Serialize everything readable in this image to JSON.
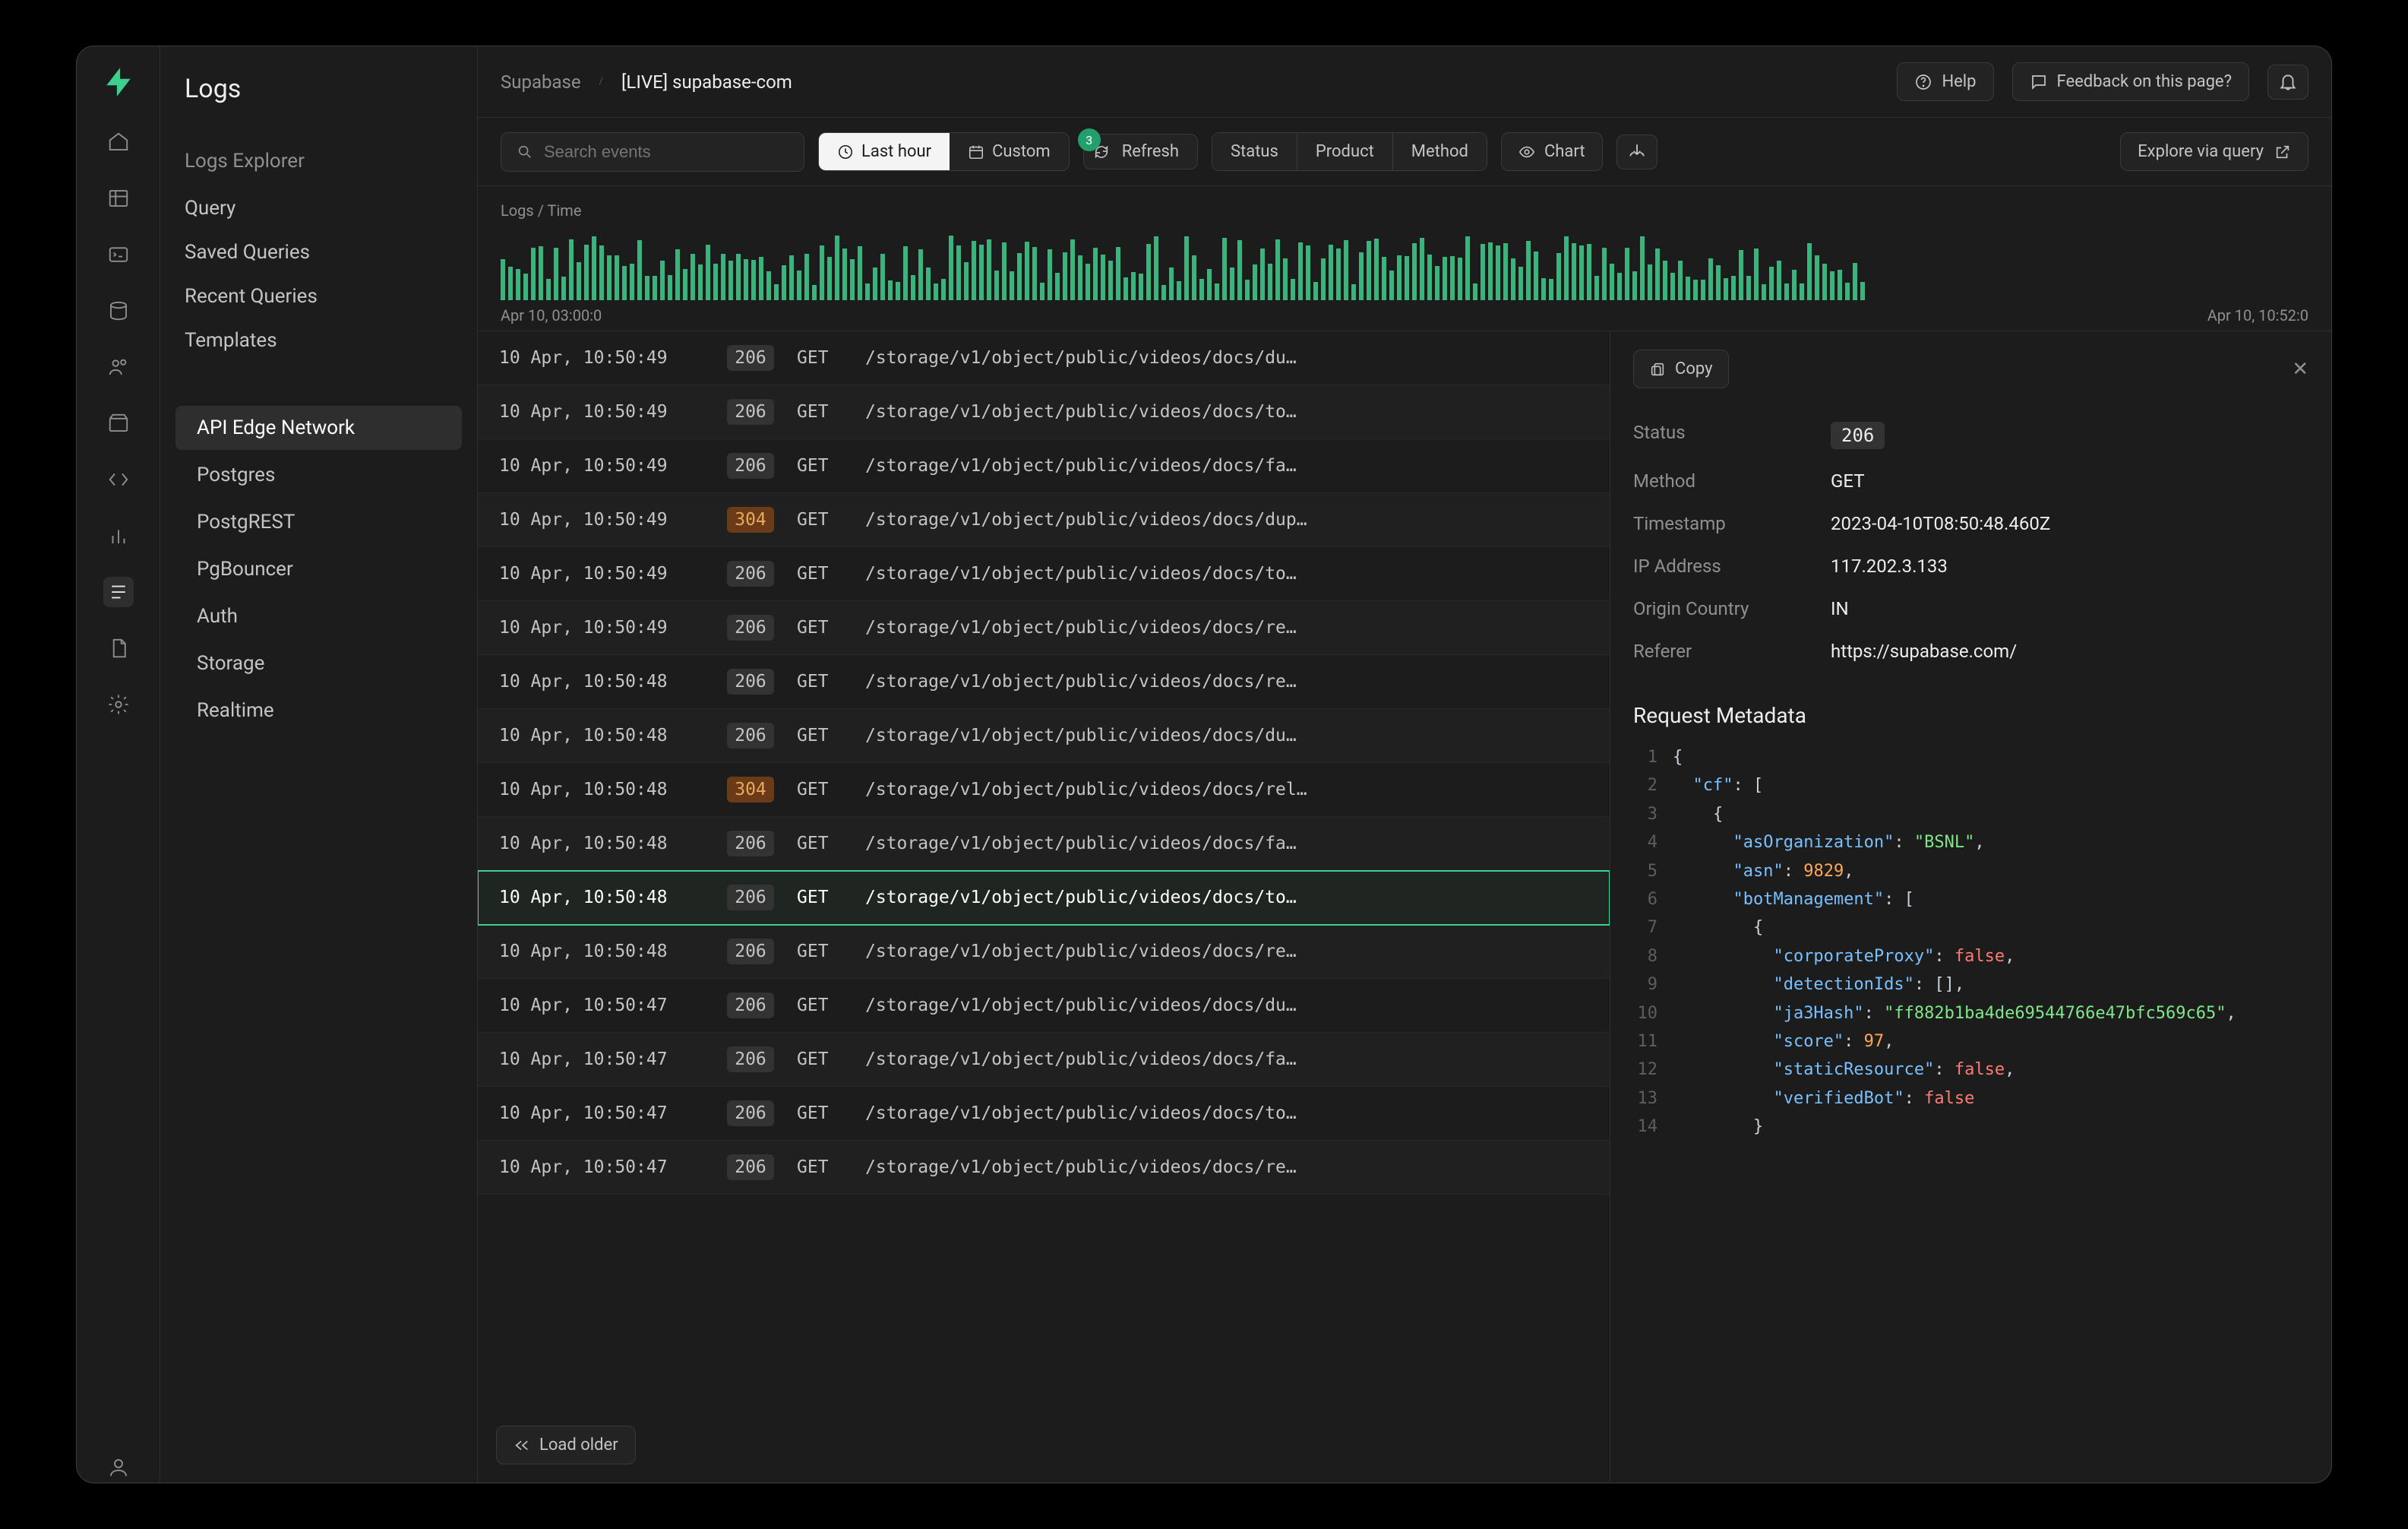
{
  "sidebar": {
    "title": "Logs",
    "explorer_title": "Logs Explorer",
    "explorer_links": [
      "Query",
      "Saved Queries",
      "Recent Queries",
      "Templates"
    ],
    "categories": [
      "API Edge Network",
      "Postgres",
      "PostgREST",
      "PgBouncer",
      "Auth",
      "Storage",
      "Realtime"
    ],
    "active": "API Edge Network"
  },
  "breadcrumb": {
    "org": "Supabase",
    "project": "[LIVE] supabase-com"
  },
  "topbar": {
    "help": "Help",
    "feedback": "Feedback on this page?"
  },
  "toolbar": {
    "search_placeholder": "Search events",
    "last_hour": "Last hour",
    "custom": "Custom",
    "refresh": "Refresh",
    "refresh_badge": "3",
    "filters": [
      "Status",
      "Product",
      "Method"
    ],
    "chart": "Chart",
    "explore": "Explore via query"
  },
  "chart": {
    "title": "Logs / Time",
    "x_start": "Apr 10, 03:00:0",
    "x_end": "Apr 10, 10:52:0"
  },
  "load_older": "Load older",
  "logs": [
    {
      "ts": "10 Apr, 10:50:49",
      "status": 206,
      "method": "GET",
      "path": "/storage/v1/object/public/videos/docs/du…"
    },
    {
      "ts": "10 Apr, 10:50:49",
      "status": 206,
      "method": "GET",
      "path": "/storage/v1/object/public/videos/docs/to…"
    },
    {
      "ts": "10 Apr, 10:50:49",
      "status": 206,
      "method": "GET",
      "path": "/storage/v1/object/public/videos/docs/fa…"
    },
    {
      "ts": "10 Apr, 10:50:49",
      "status": 304,
      "method": "GET",
      "path": "/storage/v1/object/public/videos/docs/dup…"
    },
    {
      "ts": "10 Apr, 10:50:49",
      "status": 206,
      "method": "GET",
      "path": "/storage/v1/object/public/videos/docs/to…"
    },
    {
      "ts": "10 Apr, 10:50:49",
      "status": 206,
      "method": "GET",
      "path": "/storage/v1/object/public/videos/docs/re…"
    },
    {
      "ts": "10 Apr, 10:50:48",
      "status": 206,
      "method": "GET",
      "path": "/storage/v1/object/public/videos/docs/re…"
    },
    {
      "ts": "10 Apr, 10:50:48",
      "status": 206,
      "method": "GET",
      "path": "/storage/v1/object/public/videos/docs/du…"
    },
    {
      "ts": "10 Apr, 10:50:48",
      "status": 304,
      "method": "GET",
      "path": "/storage/v1/object/public/videos/docs/rel…"
    },
    {
      "ts": "10 Apr, 10:50:48",
      "status": 206,
      "method": "GET",
      "path": "/storage/v1/object/public/videos/docs/fa…"
    },
    {
      "ts": "10 Apr, 10:50:48",
      "status": 206,
      "method": "GET",
      "path": "/storage/v1/object/public/videos/docs/to…",
      "selected": true
    },
    {
      "ts": "10 Apr, 10:50:48",
      "status": 206,
      "method": "GET",
      "path": "/storage/v1/object/public/videos/docs/re…"
    },
    {
      "ts": "10 Apr, 10:50:47",
      "status": 206,
      "method": "GET",
      "path": "/storage/v1/object/public/videos/docs/du…"
    },
    {
      "ts": "10 Apr, 10:50:47",
      "status": 206,
      "method": "GET",
      "path": "/storage/v1/object/public/videos/docs/fa…"
    },
    {
      "ts": "10 Apr, 10:50:47",
      "status": 206,
      "method": "GET",
      "path": "/storage/v1/object/public/videos/docs/to…"
    },
    {
      "ts": "10 Apr, 10:50:47",
      "status": 206,
      "method": "GET",
      "path": "/storage/v1/object/public/videos/docs/re…"
    }
  ],
  "detail": {
    "copy": "Copy",
    "fields": [
      {
        "k": "Status",
        "v": "206",
        "chip": true
      },
      {
        "k": "Method",
        "v": "GET"
      },
      {
        "k": "Timestamp",
        "v": "2023-04-10T08:50:48.460Z"
      },
      {
        "k": "IP Address",
        "v": "117.202.3.133"
      },
      {
        "k": "Origin Country",
        "v": "IN"
      },
      {
        "k": "Referer",
        "v": "https://supabase.com/"
      }
    ],
    "metadata_title": "Request Metadata",
    "code": [
      [
        [
          "punc",
          "{"
        ]
      ],
      [
        [
          "key",
          "\"cf\""
        ],
        [
          "punc",
          ": ["
        ]
      ],
      [
        [
          "punc",
          "{"
        ]
      ],
      [
        [
          "key",
          "\"asOrganization\""
        ],
        [
          "punc",
          ": "
        ],
        [
          "str",
          "\"BSNL\""
        ],
        [
          "punc",
          ","
        ]
      ],
      [
        [
          "key",
          "\"asn\""
        ],
        [
          "punc",
          ": "
        ],
        [
          "num",
          "9829"
        ],
        [
          "punc",
          ","
        ]
      ],
      [
        [
          "key",
          "\"botManagement\""
        ],
        [
          "punc",
          ": ["
        ]
      ],
      [
        [
          "punc",
          "{"
        ]
      ],
      [
        [
          "key",
          "\"corporateProxy\""
        ],
        [
          "punc",
          ": "
        ],
        [
          "bool",
          "false"
        ],
        [
          "punc",
          ","
        ]
      ],
      [
        [
          "key",
          "\"detectionIds\""
        ],
        [
          "punc",
          ": [],"
        ]
      ],
      [
        [
          "key",
          "\"ja3Hash\""
        ],
        [
          "punc",
          ": "
        ],
        [
          "str",
          "\"ff882b1ba4de69544766e47bfc569c65\""
        ],
        [
          "punc",
          ","
        ]
      ],
      [
        [
          "key",
          "\"score\""
        ],
        [
          "punc",
          ": "
        ],
        [
          "num",
          "97"
        ],
        [
          "punc",
          ","
        ]
      ],
      [
        [
          "key",
          "\"staticResource\""
        ],
        [
          "punc",
          ": "
        ],
        [
          "bool",
          "false"
        ],
        [
          "punc",
          ","
        ]
      ],
      [
        [
          "key",
          "\"verifiedBot\""
        ],
        [
          "punc",
          ": "
        ],
        [
          "bool",
          "false"
        ]
      ],
      [
        [
          "punc",
          "}"
        ]
      ]
    ]
  }
}
